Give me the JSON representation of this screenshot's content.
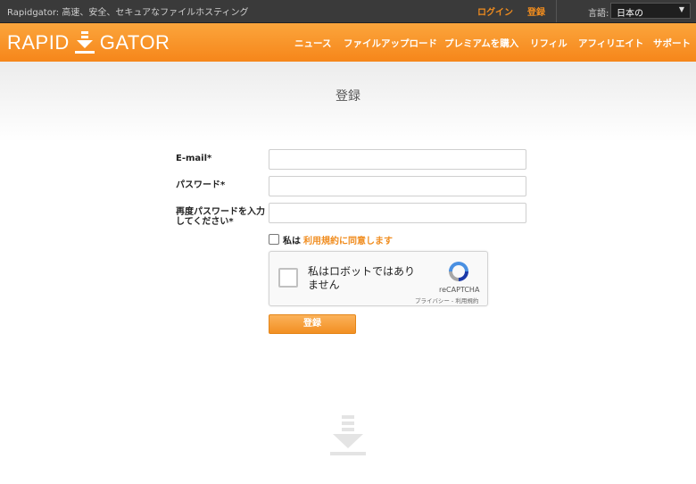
{
  "topbar": {
    "tagline": "Rapidgator: 高速、安全、セキュアなファイルホスティング",
    "login": "ログイン",
    "register": "登録",
    "language_label": "言語:",
    "language_value": "日本の"
  },
  "header": {
    "logo_left": "RAPID",
    "logo_right": "GATOR",
    "nav": [
      "ニュース",
      "ファイルアップロード",
      "プレミアムを購入",
      "リフィル",
      "アフィリエイト",
      "サポート"
    ]
  },
  "page": {
    "title": "登録"
  },
  "form": {
    "email_label": "E-mail*",
    "password_label": "パスワード*",
    "confirm_label": "再度パスワードを入力してください*",
    "terms_prefix": "私は",
    "terms_link": "利用規約に同意します",
    "captcha_text": "私はロボットではありません",
    "captcha_brand": "reCAPTCHA",
    "captcha_links": "プライバシー - 利用規約",
    "submit_label": "登録"
  },
  "colors": {
    "accent": "#f6861a",
    "link": "#f08c1e",
    "topbar": "#3a3a3a"
  },
  "icons": [
    "download-arrow-icon",
    "chevron-down-icon",
    "recaptcha-icon"
  ]
}
